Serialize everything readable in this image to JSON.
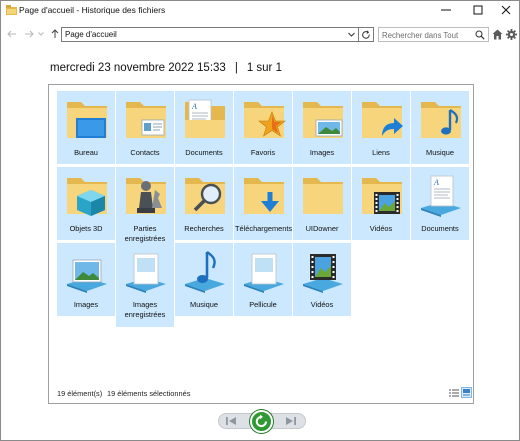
{
  "window": {
    "title": "Page d'accueil - Historique des fichiers"
  },
  "nav": {
    "address": "Page d'accueil",
    "search_placeholder": "Rechercher dans Tout"
  },
  "header": {
    "date": "mercredi 23 novembre 2022 15:33",
    "separator": "|",
    "page": "1 sur 1"
  },
  "items": [
    {
      "label": "Bureau",
      "icon": "folder-desktop-icon"
    },
    {
      "label": "Contacts",
      "icon": "folder-contacts-icon"
    },
    {
      "label": "Documents",
      "icon": "folder-documents-icon"
    },
    {
      "label": "Favoris",
      "icon": "folder-favorites-icon"
    },
    {
      "label": "Images",
      "icon": "folder-pictures-icon"
    },
    {
      "label": "Liens",
      "icon": "folder-links-icon"
    },
    {
      "label": "Musique",
      "icon": "folder-music-icon"
    },
    {
      "label": "Objets 3D",
      "icon": "folder-3d-objects-icon"
    },
    {
      "label": "Parties enregistrées",
      "icon": "folder-saved-games-icon"
    },
    {
      "label": "Recherches",
      "icon": "folder-searches-icon"
    },
    {
      "label": "Téléchargements",
      "icon": "folder-downloads-icon"
    },
    {
      "label": "UIDowner",
      "icon": "folder-icon"
    },
    {
      "label": "Vidéos",
      "icon": "folder-videos-icon"
    },
    {
      "label": "Documents",
      "icon": "library-documents-icon"
    },
    {
      "label": "Images",
      "icon": "library-pictures-icon"
    },
    {
      "label": "Images enregistrées",
      "icon": "library-saved-pictures-icon"
    },
    {
      "label": "Musique",
      "icon": "library-music-icon"
    },
    {
      "label": "Pellicule",
      "icon": "library-camera-roll-icon"
    },
    {
      "label": "Vidéos",
      "icon": "library-videos-icon"
    }
  ],
  "status": {
    "count": "19 élément(s)",
    "selected": "19 éléments sélectionnés"
  },
  "colors": {
    "selection": "#cce8ff",
    "folder": "#f5cf6a",
    "restore_button": "#2f9a33"
  }
}
